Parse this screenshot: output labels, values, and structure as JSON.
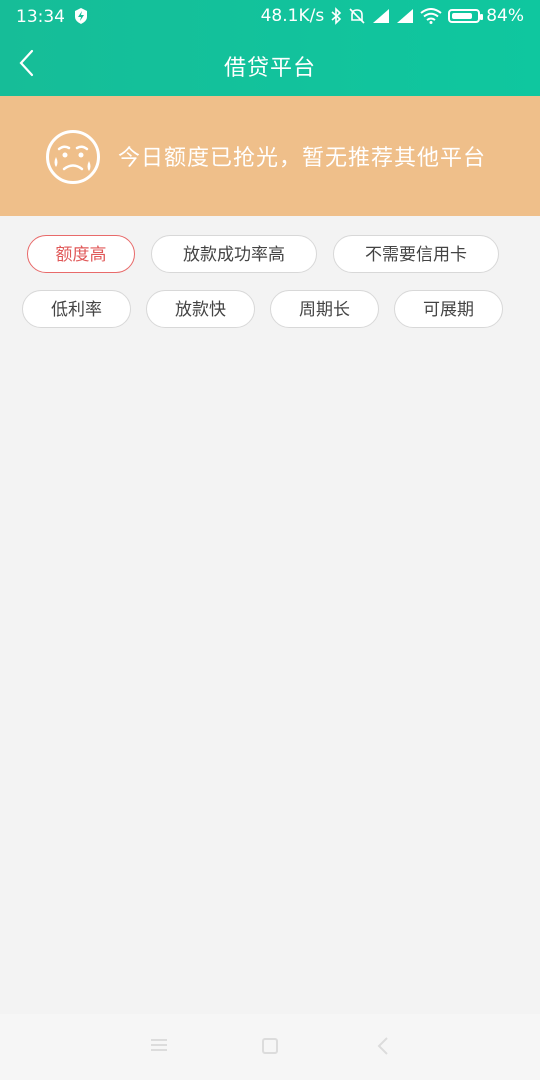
{
  "status_bar": {
    "time": "13:34",
    "net_speed": "48.1K/s",
    "battery_percent": "84%",
    "battery_level": 0.84
  },
  "header": {
    "title": "借贷平台"
  },
  "notice": {
    "message": "今日额度已抢光，暂无推荐其他平台"
  },
  "tags": [
    {
      "label": "额度高",
      "active": true
    },
    {
      "label": "放款成功率高",
      "active": false
    },
    {
      "label": "不需要信用卡",
      "active": false
    },
    {
      "label": "低利率",
      "active": false
    },
    {
      "label": "放款快",
      "active": false
    },
    {
      "label": "周期长",
      "active": false
    },
    {
      "label": "可展期",
      "active": false
    }
  ],
  "colors": {
    "header": "#16bd98",
    "notice_bg": "#efbf8a",
    "tag_active": "#e05858",
    "page_bg": "#f3f3f3"
  },
  "icons": {
    "back": "chevron-left-icon",
    "face": "crying-face-icon",
    "nav_menu": "menu-icon",
    "nav_home": "home-icon",
    "nav_back": "back-icon"
  }
}
